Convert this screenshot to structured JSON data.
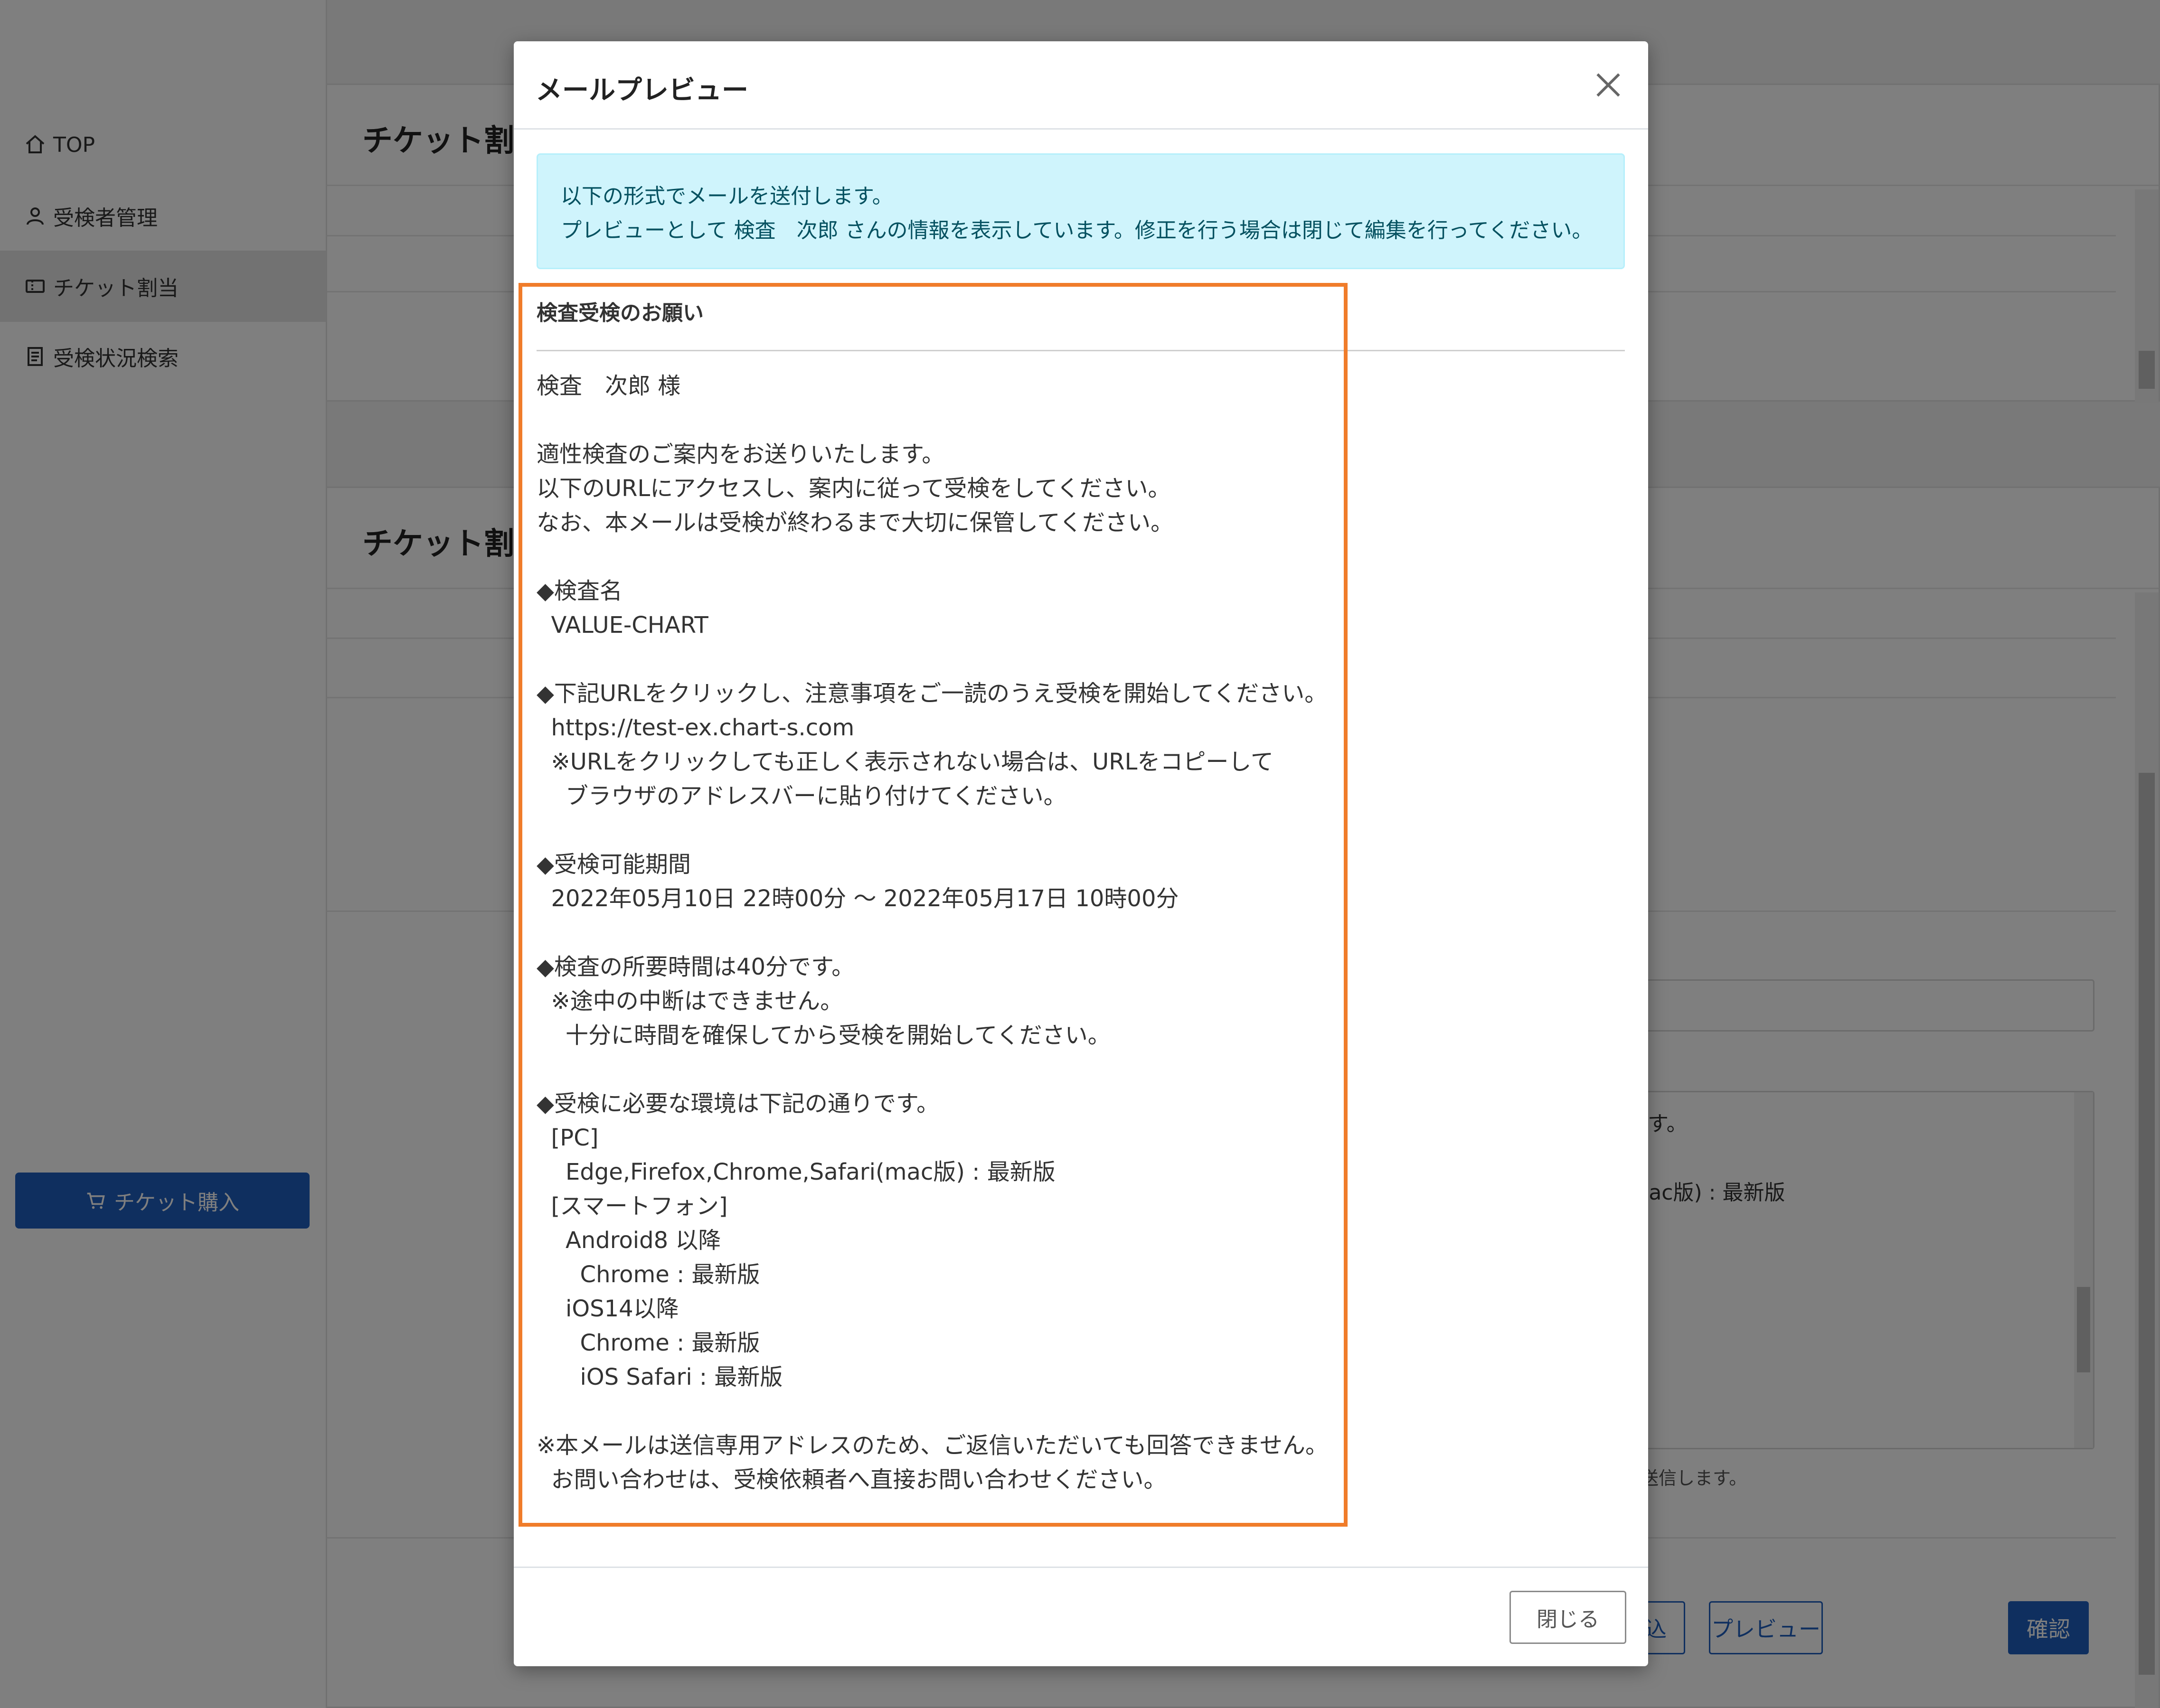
{
  "sidebar": {
    "items": [
      {
        "label": "TOP",
        "icon": "home-icon"
      },
      {
        "label": "受検者管理",
        "icon": "user-icon"
      },
      {
        "label": "チケット割当",
        "icon": "ticket-icon",
        "active": true
      },
      {
        "label": "受検状況検索",
        "icon": "document-icon"
      }
    ],
    "buy_button": "チケット購入"
  },
  "background": {
    "panel1_title": "チケット割当",
    "panel2_title": "チケット割当",
    "partial_text_1": "りです。",
    "partial_text_2": "ri(mac版) : 最新版",
    "partial_hint": "ルを送信します。",
    "btn_import": "読込",
    "btn_preview": "プレビュー",
    "btn_confirm": "確認"
  },
  "modal": {
    "title": "メールプレビュー",
    "alert_line1": "以下の形式でメールを送付します。",
    "alert_line2": "プレビューとして 検査　次郎 さんの情報を表示しています。修正を行う場合は閉じて編集を行ってください。",
    "subject": "検査受検のお願い",
    "body_lines": [
      "検査　次郎 様",
      "",
      "適性検査のご案内をお送りいたします。",
      "以下のURLにアクセスし、案内に従って受検をしてください。",
      "なお、本メールは受検が終わるまで大切に保管してください。",
      "",
      "◆検査名",
      "  VALUE-CHART",
      "",
      "◆下記URLをクリックし、注意事項をご一読のうえ受検を開始してください。",
      "  https://test-ex.chart-s.com",
      "  ※URLをクリックしても正しく表示されない場合は、URLをコピーして",
      "    ブラウザのアドレスバーに貼り付けてください。",
      "",
      "◆受検可能期間",
      "  2022年05月10日 22時00分 ～ 2022年05月17日 10時00分",
      "",
      "◆検査の所要時間は40分です。",
      "  ※途中の中断はできません。",
      "    十分に時間を確保してから受検を開始してください。",
      "",
      "◆受検に必要な環境は下記の通りです。",
      "  [PC]",
      "    Edge,Firefox,Chrome,Safari(mac版) : 最新版",
      "  [スマートフォン]",
      "    Android8 以降",
      "      Chrome : 最新版",
      "    iOS14以降",
      "      Chrome : 最新版",
      "      iOS Safari : 最新版",
      "",
      "※本メールは送信専用アドレスのため、ご返信いただいても回答できません。",
      "  お問い合わせは、受検依頼者へ直接お問い合わせください。"
    ],
    "close_button": "閉じる"
  },
  "colors": {
    "highlight": "#f07c2a",
    "alert_bg": "#cff4fc",
    "primary": "#1f5fbf"
  }
}
